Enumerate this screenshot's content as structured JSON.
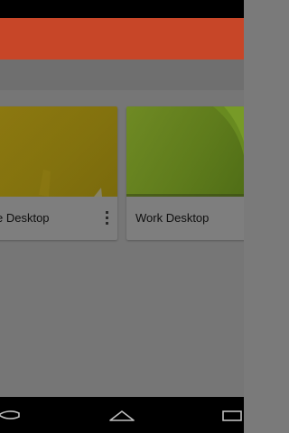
{
  "cards": [
    {
      "label": "e Desktop",
      "thumb_color": "#83720e"
    },
    {
      "label": "Work Desktop",
      "thumb_color": "#5f7c1c"
    }
  ],
  "colors": {
    "app_bar": "#e3502e",
    "scrim": "#7b7b7b",
    "status_bar": "#000000",
    "nav_bar": "#000000"
  },
  "icons": {
    "card_menu": "overflow-menu-icon",
    "nav_back": "back-icon",
    "nav_home": "home-icon",
    "nav_recent": "recent-apps-icon"
  }
}
